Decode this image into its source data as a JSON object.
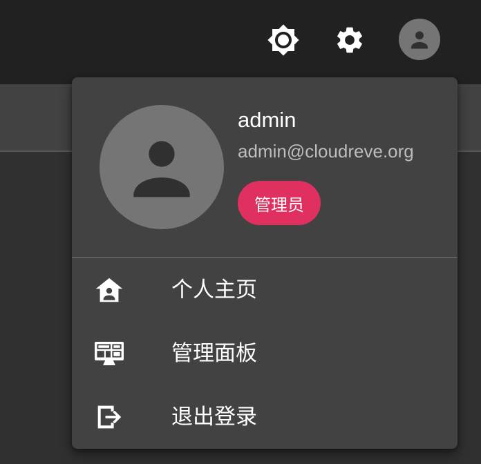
{
  "topbar": {
    "icons": [
      "brightness-icon",
      "settings-gear-icon",
      "account-avatar-icon"
    ]
  },
  "user_menu": {
    "username": "admin",
    "email": "admin@cloudreve.org",
    "role_badge": "管理员",
    "items": [
      {
        "label": "个人主页",
        "icon": "home-account-icon"
      },
      {
        "label": "管理面板",
        "icon": "admin-panel-monitor-icon"
      },
      {
        "label": "退出登录",
        "icon": "logout-icon"
      }
    ]
  },
  "colors": {
    "topbar_bg": "#212121",
    "page_bg": "#303030",
    "menu_bg": "#424242",
    "avatar_bg": "#757575",
    "badge_bg": "#e0305f"
  }
}
